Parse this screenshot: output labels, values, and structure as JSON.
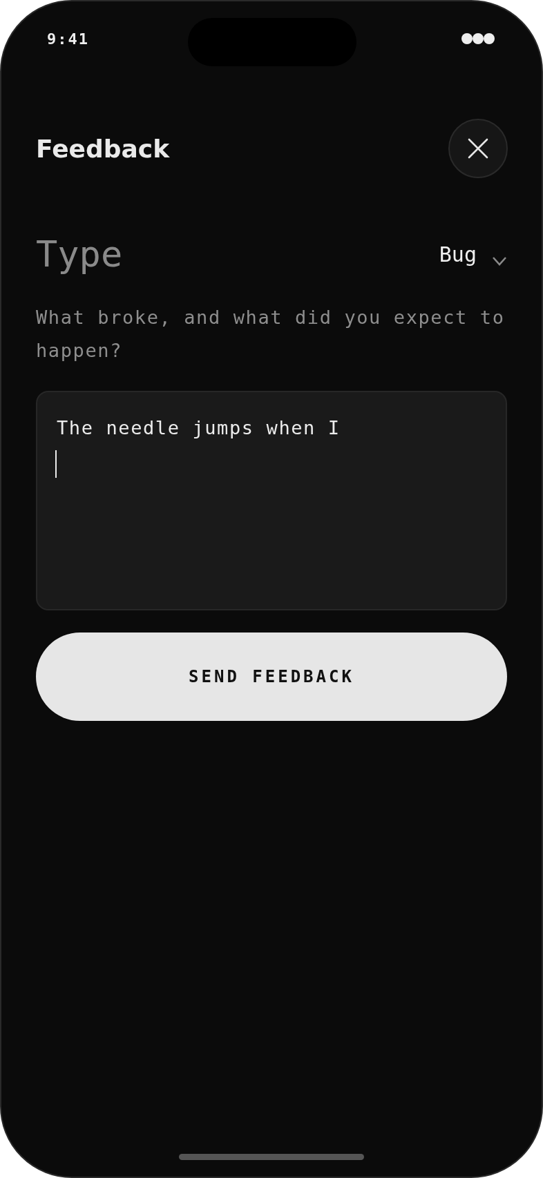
{
  "status_bar": {
    "time": "9:41"
  },
  "header": {
    "title": "Feedback"
  },
  "type_selector": {
    "label": "Type",
    "value": "Bug"
  },
  "hint": "What broke, and what did you expect to happen?",
  "feedback_field": {
    "value": "The needle jumps when I"
  },
  "submit_button": {
    "label": "SEND FEEDBACK"
  }
}
